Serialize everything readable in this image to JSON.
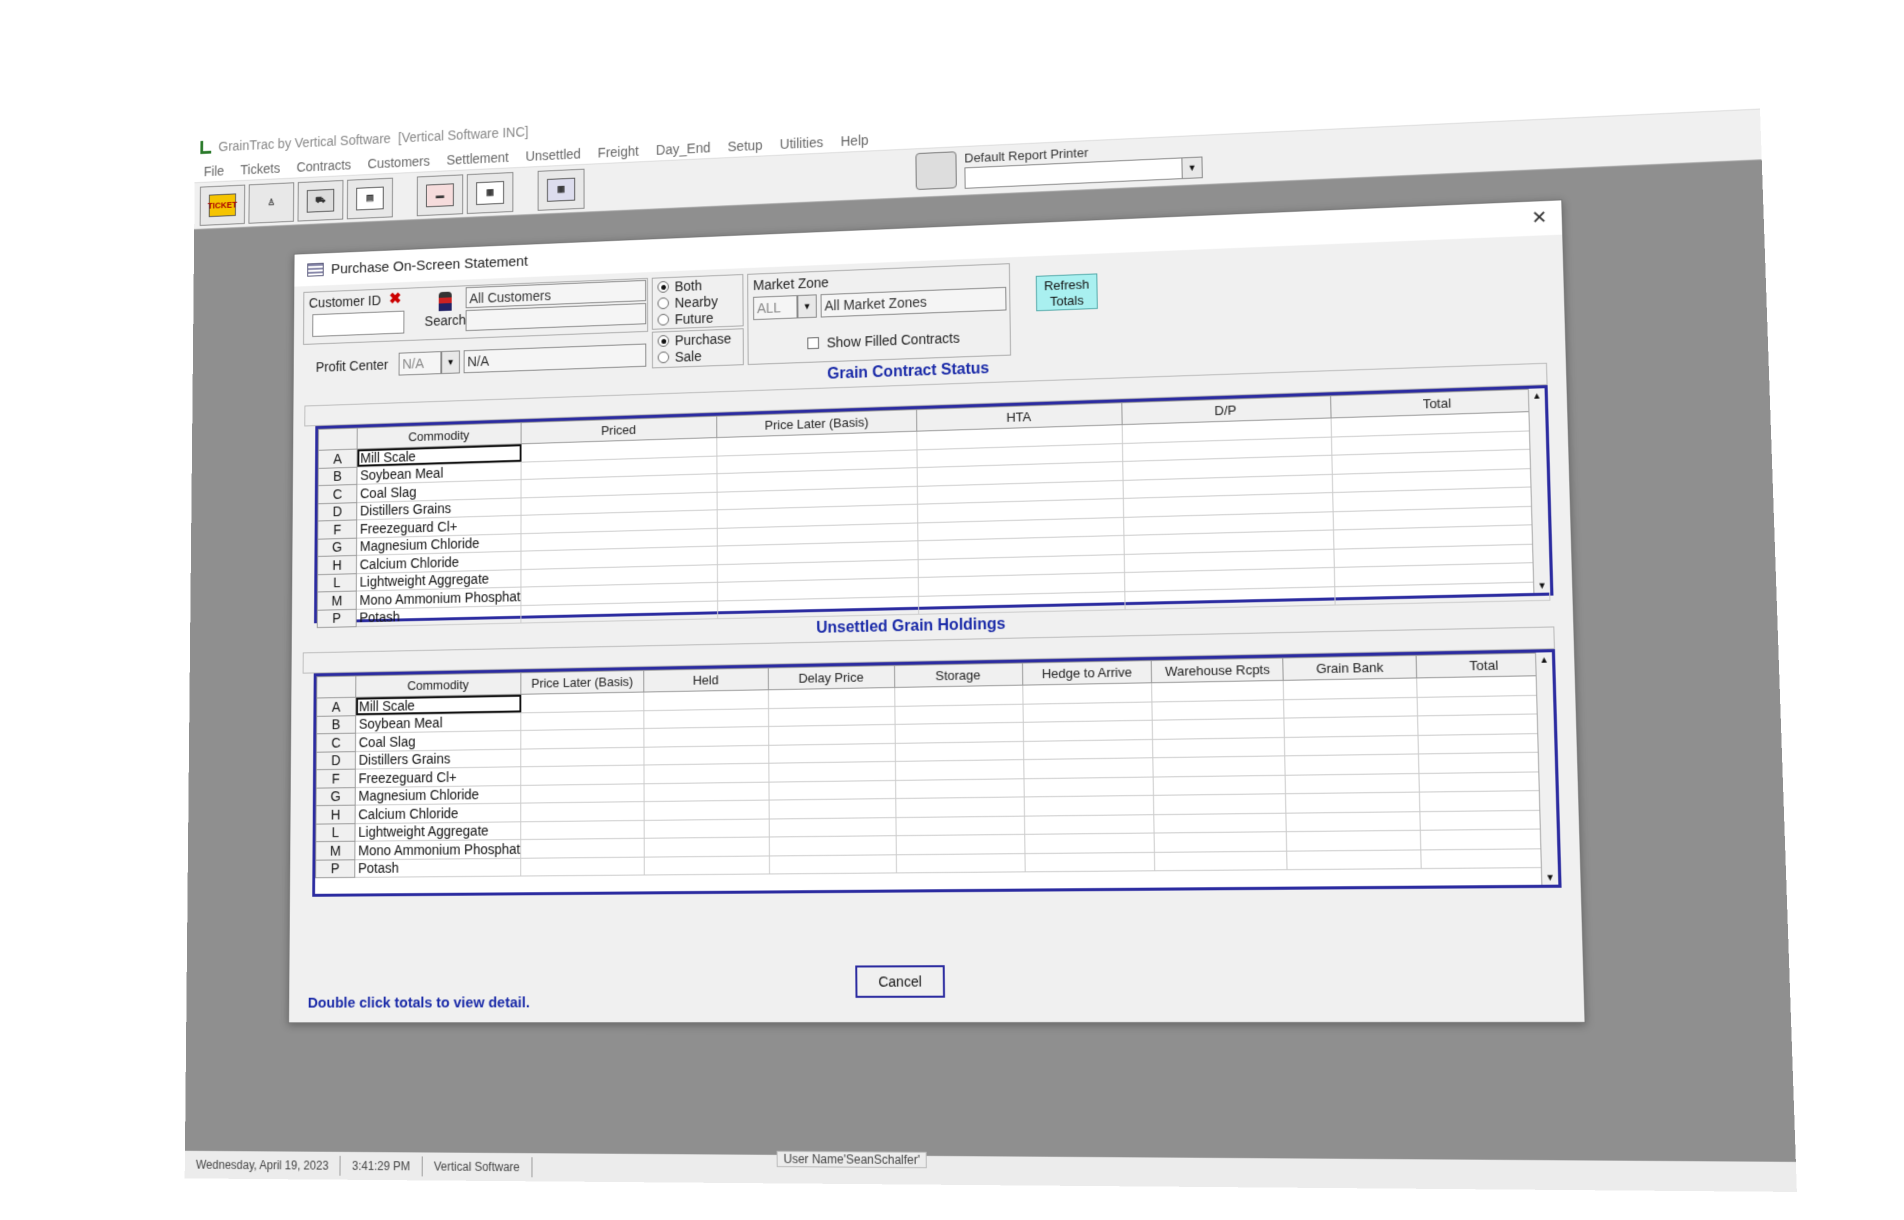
{
  "app": {
    "title": "GrainTrac by Vertical Software",
    "company": "[Vertical Software INC]"
  },
  "menu": [
    "File",
    "Tickets",
    "Contracts",
    "Customers",
    "Settlement",
    "Unsettled",
    "Freight",
    "Day_End",
    "Setup",
    "Utilities",
    "Help"
  ],
  "toolbar": {
    "ticket_label": "TICKET",
    "printer_label": "Default Report Printer",
    "printer_value": ""
  },
  "dialog": {
    "title": "Purchase On-Screen Statement",
    "customer_id_label": "Customer ID",
    "customer_id_value": "",
    "search_label": "Search",
    "customer_name": "All Customers",
    "customer_name2": "",
    "profit_center_label": "Profit Center",
    "profit_center_code": "N/A",
    "profit_center_name": "N/A",
    "term_options": [
      "Both",
      "Nearby",
      "Future"
    ],
    "term_selected": "Both",
    "type_options": [
      "Purchase",
      "Sale"
    ],
    "type_selected": "Purchase",
    "market_zone_label": "Market Zone",
    "market_zone_code": "ALL",
    "market_zone_name": "All Market Zones",
    "show_filled_label": "Show Filled Contracts",
    "refresh_label_1": "Refresh",
    "refresh_label_2": "Totals",
    "cancel_label": "Cancel",
    "hint": "Double click totals to view detail."
  },
  "contract_status": {
    "title": "Grain Contract Status",
    "columns": [
      "Commodity",
      "Priced",
      "Price Later (Basis)",
      "HTA",
      "D/P",
      "Total"
    ]
  },
  "unsettled": {
    "title": "Unsettled Grain Holdings",
    "columns": [
      "Commodity",
      "Price Later (Basis)",
      "Held",
      "Delay Price",
      "Storage",
      "Hedge to Arrive",
      "Warehouse Rcpts",
      "Grain Bank",
      "Total"
    ]
  },
  "commodities": [
    {
      "code": "A",
      "name": "Mill Scale"
    },
    {
      "code": "B",
      "name": "Soybean Meal"
    },
    {
      "code": "C",
      "name": "Coal Slag"
    },
    {
      "code": "D",
      "name": "Distillers Grains"
    },
    {
      "code": "F",
      "name": "Freezeguard Cl+"
    },
    {
      "code": "G",
      "name": "Magnesium Chloride"
    },
    {
      "code": "H",
      "name": "Calcium Chloride"
    },
    {
      "code": "L",
      "name": "Lightweight Aggregate"
    },
    {
      "code": "M",
      "name": "Mono Ammonium Phosphate"
    },
    {
      "code": "P",
      "name": "Potash"
    }
  ],
  "status": {
    "date": "Wednesday, April 19, 2023",
    "time": "3:41:29 PM",
    "company": "Vertical Software",
    "user": "User Name'SeanSchalfer'"
  }
}
